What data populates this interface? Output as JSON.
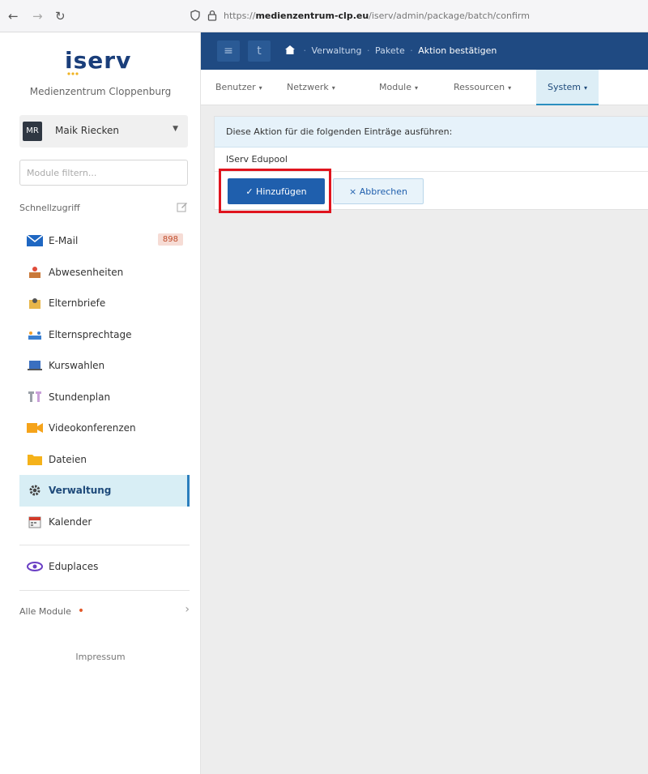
{
  "browser": {
    "url_prefix": "https://",
    "url_domain": "medienzentrum-clp.eu",
    "url_path": "/iserv/admin/package/batch/confirm"
  },
  "sidebar": {
    "logo": "iserv",
    "institution": "Medienzentrum Cloppenburg",
    "user": {
      "initials": "MR",
      "name": "Maik Riecken"
    },
    "filter_placeholder": "Module filtern...",
    "quick_access_label": "Schnellzugriff",
    "items": [
      {
        "label": "E-Mail",
        "badge": "898"
      },
      {
        "label": "Abwesenheiten"
      },
      {
        "label": "Elternbriefe"
      },
      {
        "label": "Elternsprechtage"
      },
      {
        "label": "Kurswahlen"
      },
      {
        "label": "Stundenplan"
      },
      {
        "label": "Videokonferenzen"
      },
      {
        "label": "Dateien"
      },
      {
        "label": "Verwaltung"
      },
      {
        "label": "Kalender"
      }
    ],
    "eduplaces": "Eduplaces",
    "all_modules": "Alle Module",
    "impressum": "Impressum"
  },
  "topbar": {
    "menu_icon": "≡",
    "t_icon": "t",
    "breadcrumb": [
      "Verwaltung",
      "Pakete",
      "Aktion bestätigen"
    ]
  },
  "tabs": [
    "Benutzer",
    "Netzwerk",
    "Module",
    "Ressourcen",
    "System"
  ],
  "panel": {
    "heading": "Diese Aktion für die folgenden Einträge ausführen:",
    "entry": "IServ Edupool",
    "add_label": "Hinzufügen",
    "cancel_label": "Abbrechen"
  },
  "colors": {
    "topbar": "#1f4a82",
    "primary_button": "#1f5fad",
    "highlight_box": "#e0141e",
    "active_nav": "#d8eef5"
  }
}
